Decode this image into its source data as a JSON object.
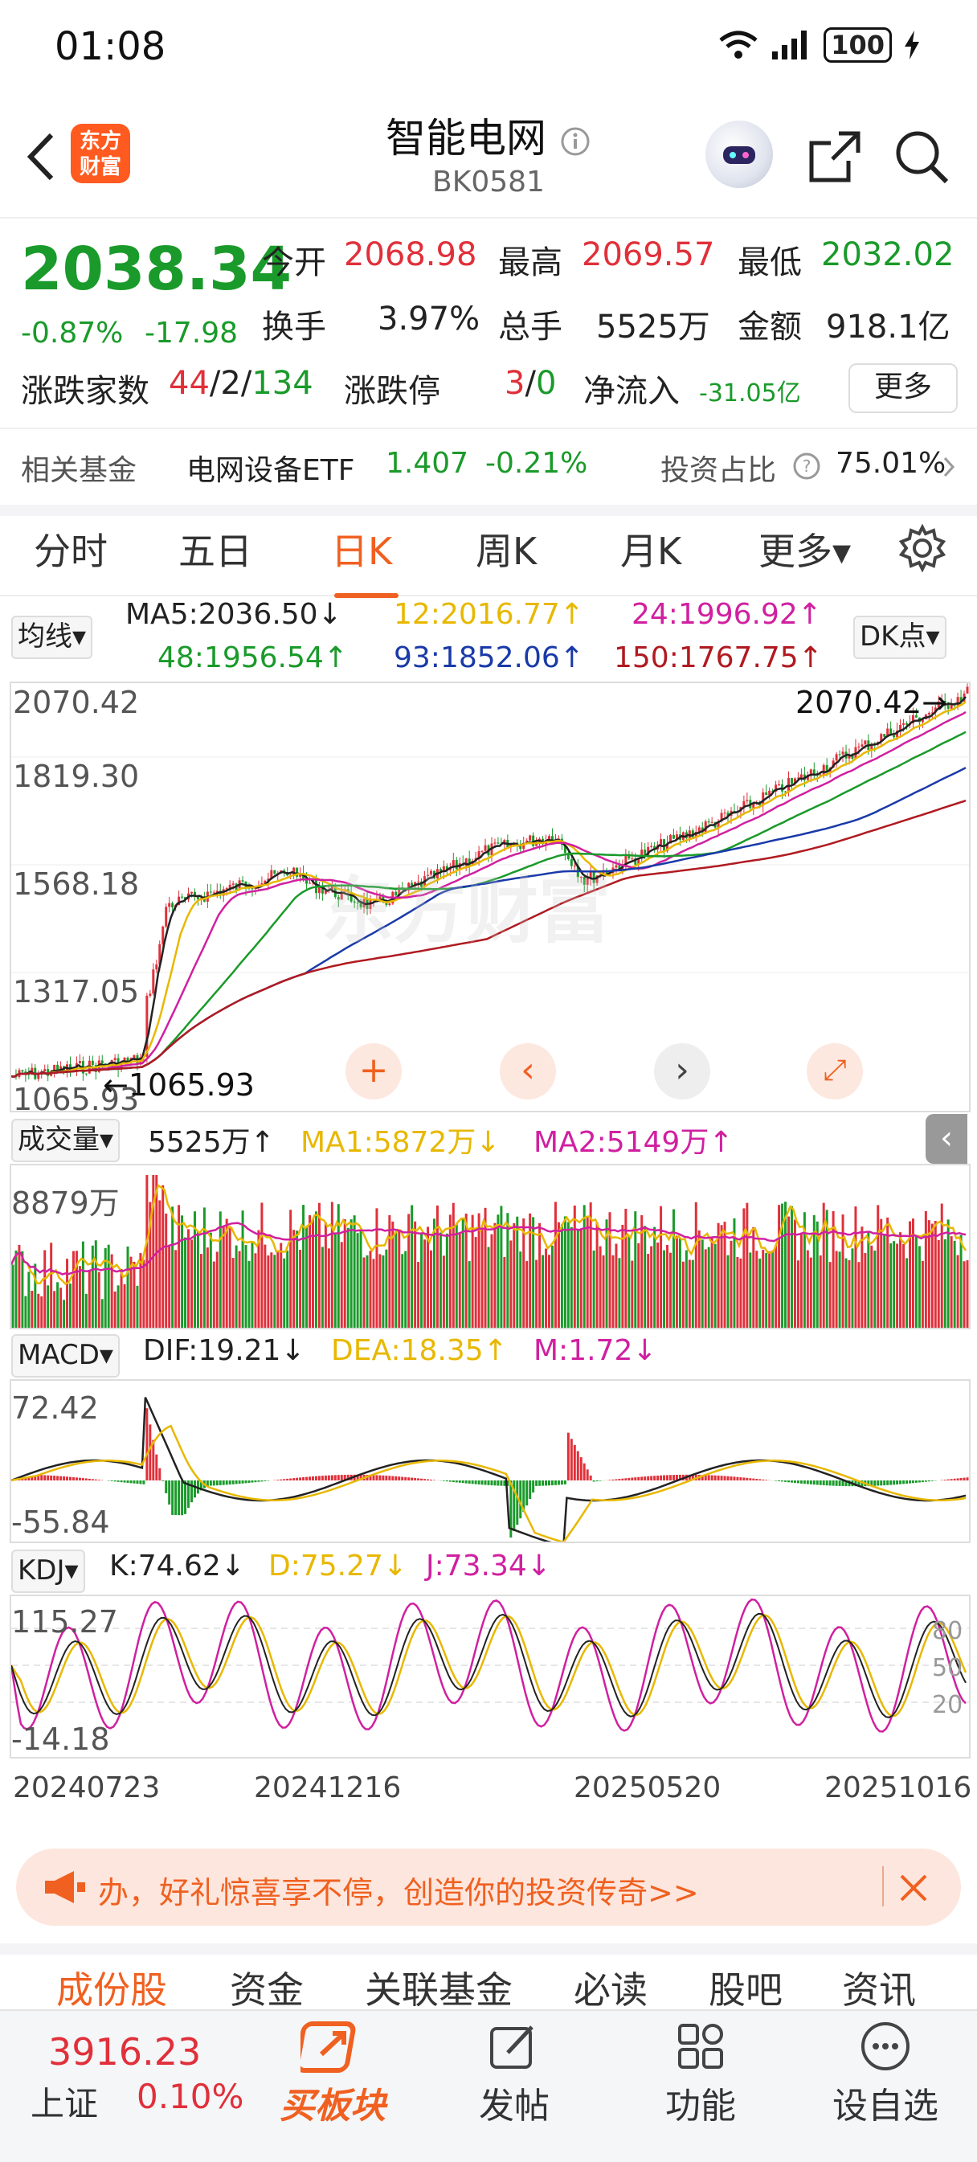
{
  "status": {
    "time": "01:08",
    "battery": "100"
  },
  "header": {
    "title": "智能电网",
    "code": "BK0581",
    "logo_line1": "东方",
    "logo_line2": "财富"
  },
  "quote": {
    "price": "2038.34",
    "pct": "-0.87%",
    "chg": "-17.98",
    "open_label": "今开",
    "open": "2068.98",
    "high_label": "最高",
    "high": "2069.57",
    "low_label": "最低",
    "low": "2032.02",
    "turnover_label": "换手",
    "turnover": "3.97%",
    "volume_label": "总手",
    "volume": "5525万",
    "amount_label": "金额",
    "amount": "918.1亿",
    "count_label": "涨跌家数",
    "up": "44",
    "flat": "2",
    "down": "134",
    "limit_label": "涨跌停",
    "limit_up": "3",
    "limit_down": "0",
    "inflow_label": "净流入",
    "inflow": "-31.05亿",
    "more": "更多"
  },
  "fund": {
    "label": "相关基金",
    "name": "电网设备ETF",
    "price": "1.407",
    "pct": "-0.21%",
    "ratio_label": "投资占比",
    "ratio": "75.01%"
  },
  "tabs": [
    "分时",
    "五日",
    "日K",
    "周K",
    "月K",
    "更多▾"
  ],
  "kline": {
    "select": "均线▾",
    "ma5": "MA5:2036.50↓",
    "ma12": "12:2016.77↑",
    "ma24": "24:1996.92↑",
    "ma48": "48:1956.54↑",
    "ma93": "93:1852.06↑",
    "ma150": "150:1767.75↑",
    "dk": "DK点▾",
    "y1": "2070.42",
    "y2": "1819.30",
    "y3": "1568.18",
    "y4": "1317.05",
    "y5": "1065.93",
    "max_label": "2070.42→",
    "min_label": "←1065.93",
    "watermark": "东方财富"
  },
  "volume": {
    "select": "成交量▾",
    "value": "5525万↑",
    "ma1": "MA1:5872万↓",
    "ma2": "MA2:5149万↑",
    "ymax": "8879万"
  },
  "macd": {
    "select": "MACD▾",
    "dif": "DIF:19.21↓",
    "dea": "DEA:18.35↑",
    "m": "M:1.72↓",
    "ymax": "72.42",
    "ymin": "-55.84"
  },
  "kdj": {
    "select": "KDJ▾",
    "k": "K:74.62↓",
    "d": "D:75.27↓",
    "j": "J:73.34↓",
    "ymax": "115.27",
    "ymin": "-14.18",
    "l80": "80",
    "l50": "50",
    "l20": "20"
  },
  "dates": [
    "20240723",
    "20241216",
    "20250520",
    "20251016"
  ],
  "banner": {
    "text": "办，好礼惊喜享不停，创造你的投资传奇>>"
  },
  "subtabs": [
    "成份股",
    "资金",
    "关联基金",
    "必读",
    "股吧",
    "资讯"
  ],
  "bottom": {
    "index_value": "3916.23",
    "index_name": "上证",
    "index_pct": "0.10%",
    "nav": [
      "买板块",
      "发帖",
      "功能",
      "设自选"
    ]
  }
}
